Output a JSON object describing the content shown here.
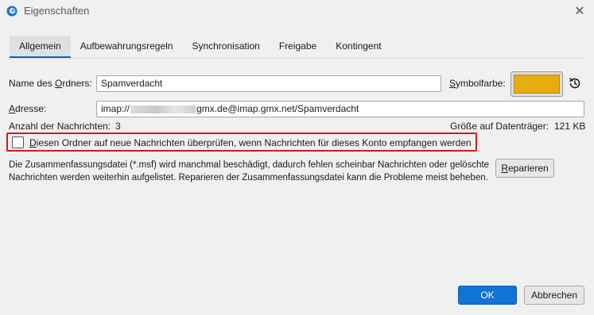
{
  "window": {
    "title": "Eigenschaften",
    "close_glyph": "✕",
    "icon": "thunderbird-icon"
  },
  "tabs": [
    {
      "label": "Allgemein",
      "active": true
    },
    {
      "label": "Aufbewahrungsregeln",
      "active": false
    },
    {
      "label": "Synchronisation",
      "active": false
    },
    {
      "label": "Freigabe",
      "active": false
    },
    {
      "label": "Kontingent",
      "active": false
    }
  ],
  "general": {
    "folder_name_label_pre": "Name des ",
    "folder_name_label_key": "O",
    "folder_name_label_post": "rdners:",
    "folder_name_value": "Spamverdacht",
    "icon_color_label_pre": "",
    "icon_color_label_key": "S",
    "icon_color_label_post": "ymbolfarbe:",
    "icon_color": "#e7ac0d",
    "address_label_pre": "",
    "address_label_key": "A",
    "address_label_post": "dresse:",
    "address_prefix": "imap://",
    "address_suffix": "gmx.de@imap.gmx.net/Spamverdacht",
    "message_count_label": "Anzahl der Nachrichten:",
    "message_count": "3",
    "disk_size_label": "Größe auf Datenträger:",
    "disk_size": "121 KB",
    "check_new_label_pre": "",
    "check_new_label_key": "D",
    "check_new_label_post": "iesen Ordner auf neue Nachrichten überprüfen, wenn Nachrichten für dieses Konto empfangen werden",
    "check_new_checked": false,
    "repair_description": "Die Zusammenfassungsdatei (*.msf) wird manchmal beschädigt, dadurch fehlen scheinbar Nachrichten oder gelöschte Nachrichten werden weiterhin aufgelistet. Reparieren der Zusammenfassungsdatei kann die Probleme meist beheben.",
    "repair_button_pre": "",
    "repair_button_key": "R",
    "repair_button_post": "eparieren"
  },
  "footer": {
    "ok_label": "OK",
    "cancel_label": "Abbrechen"
  }
}
